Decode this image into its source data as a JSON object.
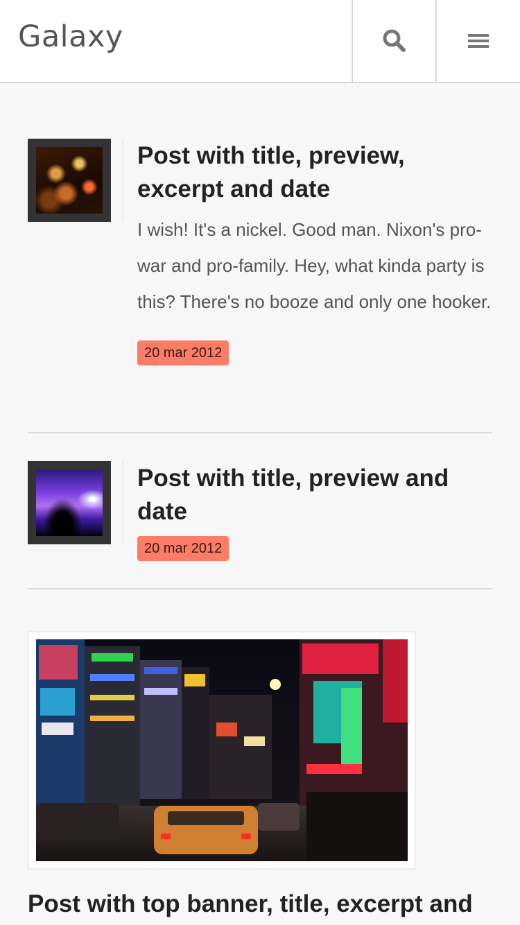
{
  "header": {
    "brand": "Galaxy",
    "search_icon": "search-icon",
    "menu_icon": "hamburger-menu-icon"
  },
  "posts": [
    {
      "title": "Post with title, preview, excerpt and date",
      "excerpt": "I wish! It's a nickel. Good man. Nixon's pro-war and pro-family. Hey, what kinda party is this? There's no booze and only one hooker.",
      "date": "20 mar 2012",
      "preview": "night-lights-photo"
    },
    {
      "title": "Post with title, preview and date",
      "date": "20 mar 2012",
      "preview": "concert-dj-photo"
    },
    {
      "title": "Post with top banner, title, excerpt and",
      "banner": "tokyo-night-street-photo"
    }
  ],
  "colors": {
    "background": "#f7f7f7",
    "date_badge": "#fa7d67",
    "header_bg": "#ffffff"
  }
}
